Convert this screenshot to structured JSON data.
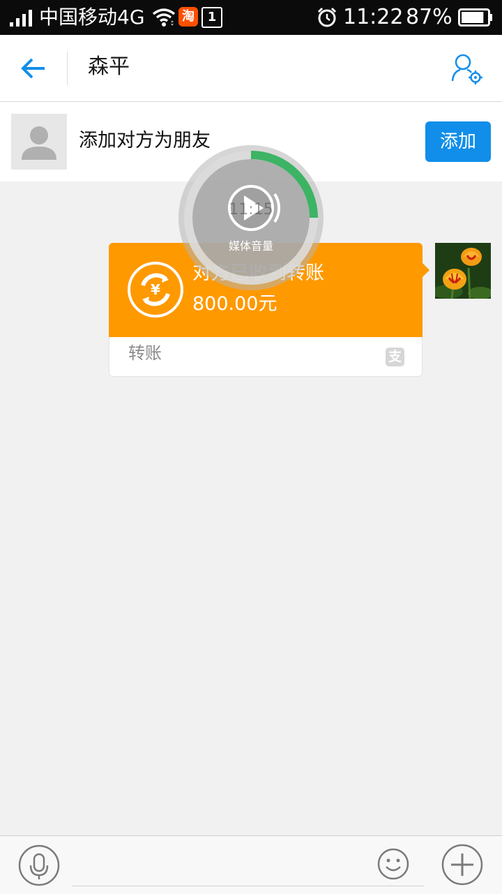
{
  "status_bar": {
    "carrier": "中国移动4G",
    "taobao_badge": "淘",
    "sim_badge": "1",
    "time": "11:22",
    "battery_pct": "87%",
    "battery_level": 0.87
  },
  "header": {
    "title": "森平",
    "back_icon": "back-arrow-icon",
    "profile_icon": "user-settings-icon",
    "accent_color": "#118ee9"
  },
  "friend_banner": {
    "text": "添加对方为朋友",
    "add_button": "添加"
  },
  "message": {
    "status": "对方已收到转账",
    "amount": "800.00元",
    "footer_label": "转账",
    "footer_badge": "支",
    "card_color": "#ff9900"
  },
  "volume_overlay": {
    "time": "11:15",
    "label": "媒体音量",
    "level": 0.25,
    "level_color": "#3cb464"
  },
  "input_bar": {
    "placeholder": "",
    "voice_icon": "microphone-icon",
    "emoji_icon": "smiley-icon",
    "plus_icon": "plus-icon"
  }
}
